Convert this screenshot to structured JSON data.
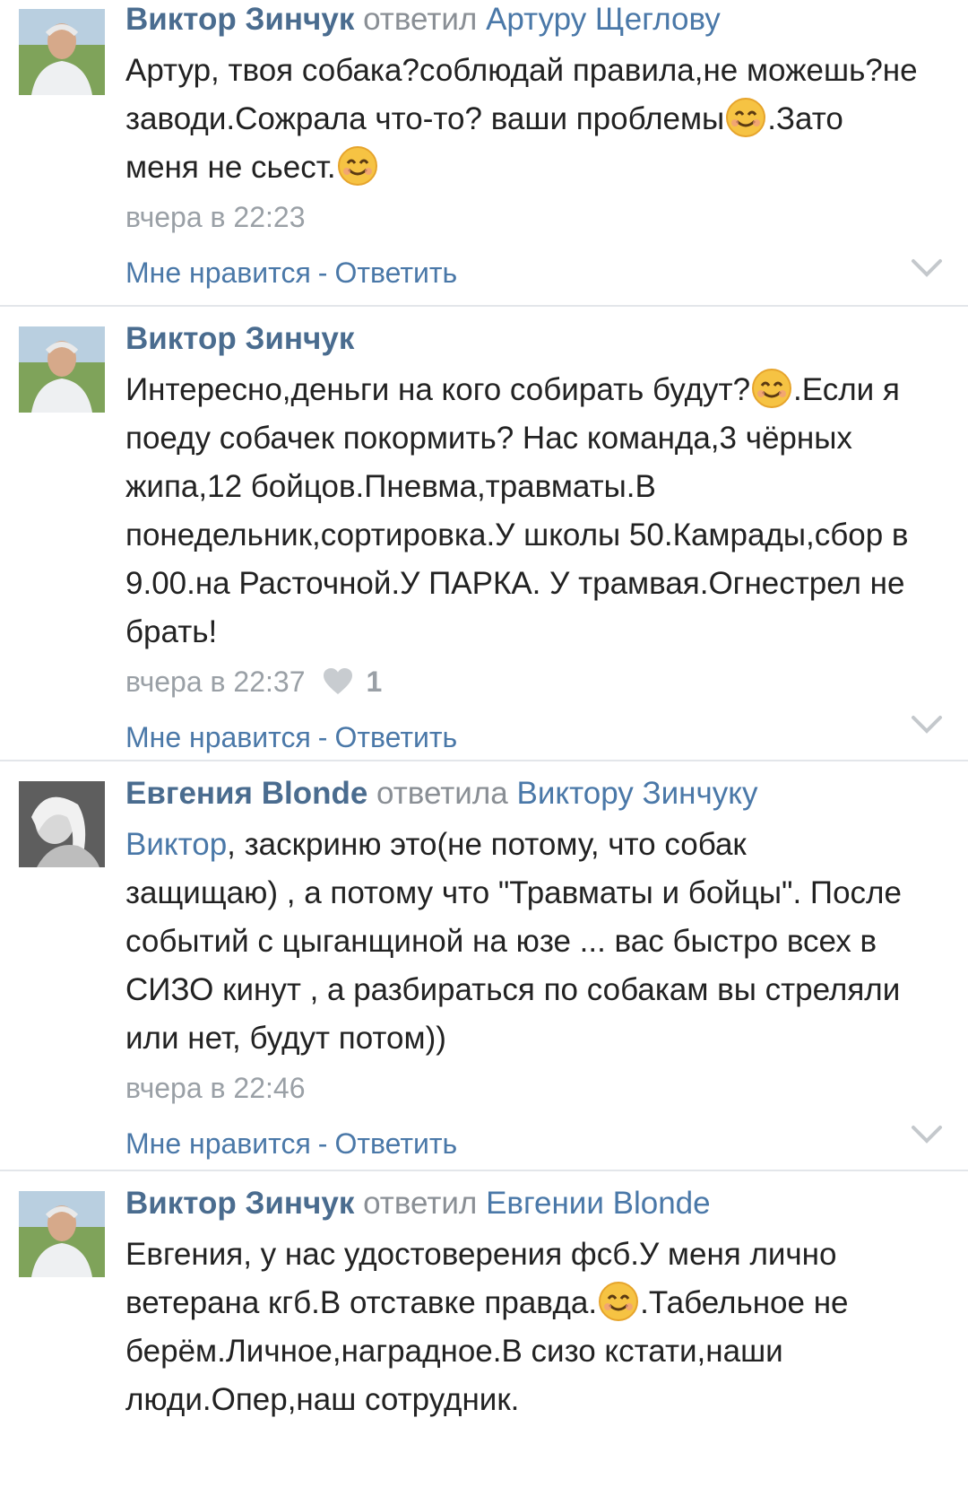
{
  "comments": [
    {
      "author": "Виктор Зинчук",
      "verb": "ответил",
      "target": "Артуру Щеглову",
      "text": [
        "Артур, твоя собака?соблюдай правила,не можешь?не",
        "заводи.Сожрала что-то? ваши проблемы",
        ".Зато",
        "меня не сьест."
      ],
      "time": "вчера в 22:23",
      "like_label": "Мне нравится",
      "separator": "-",
      "reply_label": "Ответить"
    },
    {
      "author": "Виктор Зинчук",
      "text": [
        "Интересно,деньги на кого собирать будут?",
        ".Если я",
        "поеду собачек покормить? Нас команда,3 чёрных",
        "жипа,12 бойцов.Пневма,травматы.В",
        "понедельник,сортировка.У школы 50.Камрады,сбор в",
        "9.00.на Расточной.У ПАРКА. У трамвая.Огнестрел не",
        "брать!"
      ],
      "time": "вчера в 22:37",
      "likes": "1",
      "like_label": "Мне нравится",
      "separator": "-",
      "reply_label": "Ответить"
    },
    {
      "author": "Евгения Blonde",
      "verb": "ответила",
      "target": "Виктору Зинчуку",
      "mention": "Виктор",
      "text": [
        ", заскриню это(не потому, что собак",
        "защищаю) , а потому что \"Травматы и бойцы\". После",
        "событий с цыганщиной на юзе ... вас быстро всех в",
        "СИЗО кинут , а разбираться по собакам вы стреляли",
        "или нет, будут потом))"
      ],
      "time": "вчера в 22:46",
      "like_label": "Мне нравится",
      "separator": "-",
      "reply_label": "Ответить"
    },
    {
      "author": "Виктор Зинчук",
      "verb": "ответил",
      "target": "Евгении Blonde",
      "text": [
        "Евгения, у нас удостоверения фсб.У меня лично",
        "ветерана кгб.В отставке правда.",
        ".Табельное не",
        "берём.Личное,наградное.В сизо кстати,наши",
        "люди.Опер,наш сотрудник."
      ]
    }
  ],
  "colors": {
    "author": "#4a6c8f",
    "link": "#4a78a8",
    "meta": "#9aa0a6",
    "divider": "#e3e6ea"
  },
  "icons": [
    "avatar",
    "smile-emoji-icon",
    "heart-icon",
    "chevron-down-icon"
  ]
}
